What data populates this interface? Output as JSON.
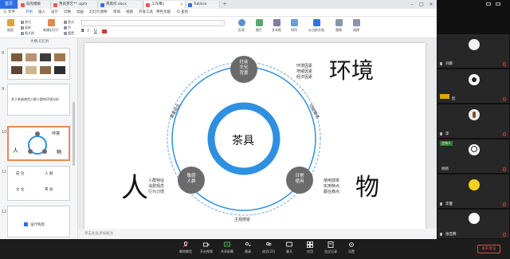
{
  "tabs": [
    {
      "label": "首页",
      "icon": "home-icon"
    },
    {
      "label": "稻壳模板",
      "icon": "template-icon",
      "color": "#e85a4f"
    },
    {
      "label": "茶具茶艺** .pptx",
      "icon": "ppt-icon",
      "color": "#e85a4f"
    },
    {
      "label": "茶席作.docx",
      "icon": "doc-icon",
      "color": "#2f6fe4"
    },
    {
      "label": "工作簿1",
      "icon": "ppt-icon",
      "color": "#e85a4f"
    },
    {
      "label": "Tubisse",
      "icon": "image-icon",
      "color": "#2f6fe4"
    }
  ],
  "menu": [
    "三 文件",
    "开始",
    "插入",
    "设计",
    "切换",
    "动画",
    "幻灯片放映",
    "审阅",
    "视图",
    "开发工具",
    "特色功能",
    "Q 查找"
  ],
  "active_menu": 1,
  "toolbar": {
    "paste": "粘贴",
    "new_slide": "新建幻灯片",
    "shape": "形状",
    "picture": "图片",
    "textbox": "文本框",
    "arrange": "排列",
    "current_slide": "从当前开始",
    "replace": "替换",
    "select": "选择",
    "small_items": [
      "剪切",
      "复制",
      "格式刷",
      "版式",
      "节",
      "重置"
    ]
  },
  "thumbs_title": "大纲 幻灯片",
  "slide_numbers": [
    "8",
    "9",
    "10",
    "11",
    "12"
  ],
  "thumb_texts": {
    "t9": "关于茶具使用人群人群的环境分析",
    "t10_env": "环境",
    "t10_ren": "人",
    "t10_wu": "物",
    "t11": [
      "成 功",
      "文 化",
      "人 群",
      "茶 具"
    ],
    "t12": "设计构思"
  },
  "slide": {
    "center": "茶具",
    "nodes": {
      "top": "社会\n文化\n背景",
      "left": "敬感\n人群",
      "right": "日常\n使用"
    },
    "big_labels": {
      "env": "环境",
      "ren": "人",
      "wu": "物"
    },
    "notes_env": [
      "环境因素",
      "地域因素",
      "经济因素"
    ],
    "notes_ren": [
      "人群特征",
      "消费观念",
      "行为习惯"
    ],
    "notes_wu": [
      "使用感率",
      "实用特点",
      "跟在痛点"
    ],
    "arc_labels": {
      "left": "审美观念",
      "right": "功能需求",
      "bottom": "主观感受"
    }
  },
  "colors": {
    "accent": "#2f8fe0",
    "node": "#6b6b6b",
    "orbit": "#7fb2e6"
  },
  "notes_bar": "单击此处添加备注",
  "participants": [
    {
      "name": "刘鹏",
      "tag": ""
    },
    {
      "name": "彭",
      "tag": ""
    },
    {
      "name": "李",
      "tag": "正在讲话"
    },
    {
      "name": "杨扬",
      "tag": "主持人"
    },
    {
      "name": "李蔓",
      "tag": ""
    },
    {
      "name": "张芸腾",
      "tag": ""
    },
    {
      "name": "日晴春",
      "tag": ""
    }
  ],
  "meeting": {
    "buttons": [
      "解除静音",
      "开启视频",
      "共享屏幕",
      "邀请",
      "成员(22)",
      "聊天",
      "应用",
      "会议记录",
      "设置"
    ],
    "leave": "离开会议"
  }
}
